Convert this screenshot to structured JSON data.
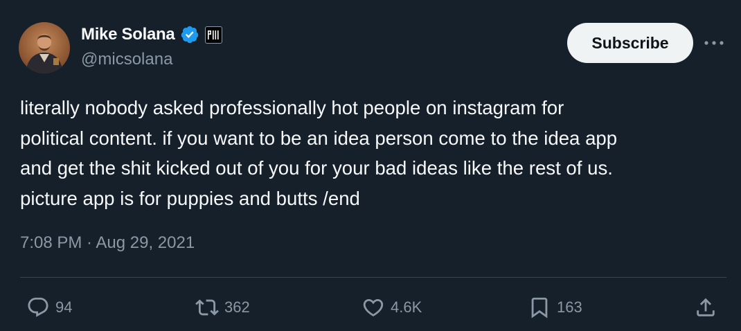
{
  "author": {
    "display_name": "Mike Solana",
    "handle": "@micsolana",
    "verified": true,
    "affiliate_badge_text": "PIII"
  },
  "header": {
    "subscribe_label": "Subscribe",
    "more_icon": "more-horizontal-icon"
  },
  "tweet": {
    "text": "literally nobody asked professionally hot people on instagram for\npolitical content. if you want to be an idea person come to the idea app\nand get the shit kicked out of you for your bad ideas like the rest of us.\npicture app is for puppies and butts /end",
    "timestamp": "7:08 PM · Aug 29, 2021"
  },
  "actions": {
    "replies": "94",
    "retweets": "362",
    "likes": "4.6K",
    "bookmarks": "163"
  },
  "colors": {
    "background": "#15202b",
    "text_primary": "#f7f9f9",
    "text_secondary": "#8b98a5",
    "verified_blue": "#1d9bf0",
    "divider": "#38444d",
    "button_bg": "#eff3f4"
  }
}
